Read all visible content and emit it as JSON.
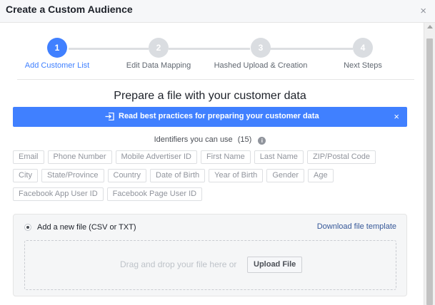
{
  "dialog": {
    "title": "Create a Custom Audience",
    "close_symbol": "×"
  },
  "steps": [
    {
      "number": "1",
      "label": "Add Customer List",
      "active": true
    },
    {
      "number": "2",
      "label": "Edit Data Mapping",
      "active": false
    },
    {
      "number": "3",
      "label": "Hashed Upload & Creation",
      "active": false
    },
    {
      "number": "4",
      "label": "Next Steps",
      "active": false
    }
  ],
  "main": {
    "title": "Prepare a file with your customer data",
    "banner": {
      "icon": "sign-in-icon",
      "text": "Read best practices for preparing your customer data",
      "close_symbol": "×"
    },
    "identifiers": {
      "label": "Identifiers you can use",
      "count": "(15)",
      "info_icon": "i",
      "rows": [
        [
          "Email",
          "Phone Number",
          "Mobile Advertiser ID",
          "First Name",
          "Last Name",
          "ZIP/Postal Code"
        ],
        [
          "City",
          "State/Province",
          "Country",
          "Date of Birth",
          "Year of Birth",
          "Gender",
          "Age"
        ],
        [
          "Facebook App User ID",
          "Facebook Page User ID"
        ]
      ]
    },
    "upload": {
      "option_label": "Add a new file (CSV or TXT)",
      "download_link": "Download file template",
      "drop_text": "Drag and drop your file here or",
      "button_label": "Upload File"
    }
  },
  "colors": {
    "accent": "#4080ff",
    "link": "#365899",
    "inactive_step": "#dadde1"
  }
}
